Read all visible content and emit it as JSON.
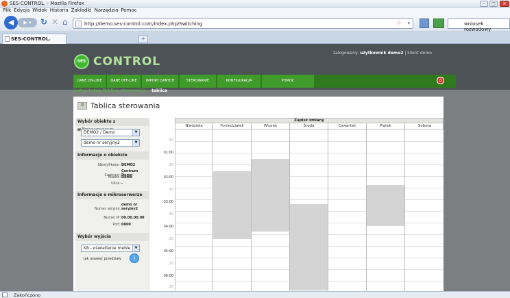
{
  "window": {
    "title": "SES-CONTROL. - Mozilla Firefox"
  },
  "menu": [
    "Plik",
    "Edycja",
    "Widok",
    "Historia",
    "Zakładki",
    "Narzędzia",
    "Pomoc"
  ],
  "browser": {
    "url": "http://demo.ses-control.com/index.php/Switching",
    "search_value": "wniosek rozwodowy",
    "tab_label": "SES-CONTROL.",
    "newtab": "+"
  },
  "site": {
    "logo_badge": "SES",
    "logo_text": "CONTROL",
    "login_prefix": "zalogowany:",
    "login_user": "użytkownik demo2",
    "login_suffix": "| klient demo",
    "nav": [
      "DANE ON-LINE",
      "DANE OFF-LINE",
      "IMPORT DANYCH",
      "STEROWANIE",
      "KONFIGURACJA",
      "POMOC"
    ],
    "breadcrumb_prefix": "jesteś tutaj: Tablica sterowania »",
    "breadcrumb_current": "tablica"
  },
  "panel": {
    "title": "Tablica sterowania",
    "sec_object": "Wybór obiektu z mikroserwerem",
    "select_object": "DEMO2 / Demo",
    "select_serial": "demo nr seryjny2",
    "sec_info": "Informacje o obiekcie",
    "info": [
      {
        "k": "Identyfikator:",
        "v": "DEMO2"
      },
      {
        "k": "Centrum:",
        "v": "Centrum Demo"
      },
      {
        "k": "Miasto:",
        "v": "Demo"
      },
      {
        "k": "Ulica:",
        "v": "-"
      }
    ],
    "sec_micro": "Informacje o mikroserwerze",
    "micro": [
      {
        "k": "Numer seryjny:",
        "v": "demo nr seryjny2"
      },
      {
        "k": "Numer IP:",
        "v": "00.00.00.00"
      },
      {
        "k": "Port:",
        "v": "0000"
      }
    ],
    "sec_output": "Wybór wyjścia",
    "select_output": "K8 - oświetlenie meble",
    "remove_ranges": "Jak usuwać przedziały"
  },
  "schedule": {
    "save": "Zapisz zmiany",
    "days": [
      "Niedziela",
      "Poniedziałek",
      "Wtorek",
      "Środa",
      "Czwartek",
      "Piątek",
      "Sobota"
    ],
    "times": [
      ":30",
      "01:00",
      ":30",
      "02:00",
      ":30",
      "03:00",
      ":30",
      "04:00",
      ":30",
      "05:00",
      ":30",
      "06:00",
      ":30"
    ]
  },
  "status": {
    "text": "Zakończono"
  }
}
